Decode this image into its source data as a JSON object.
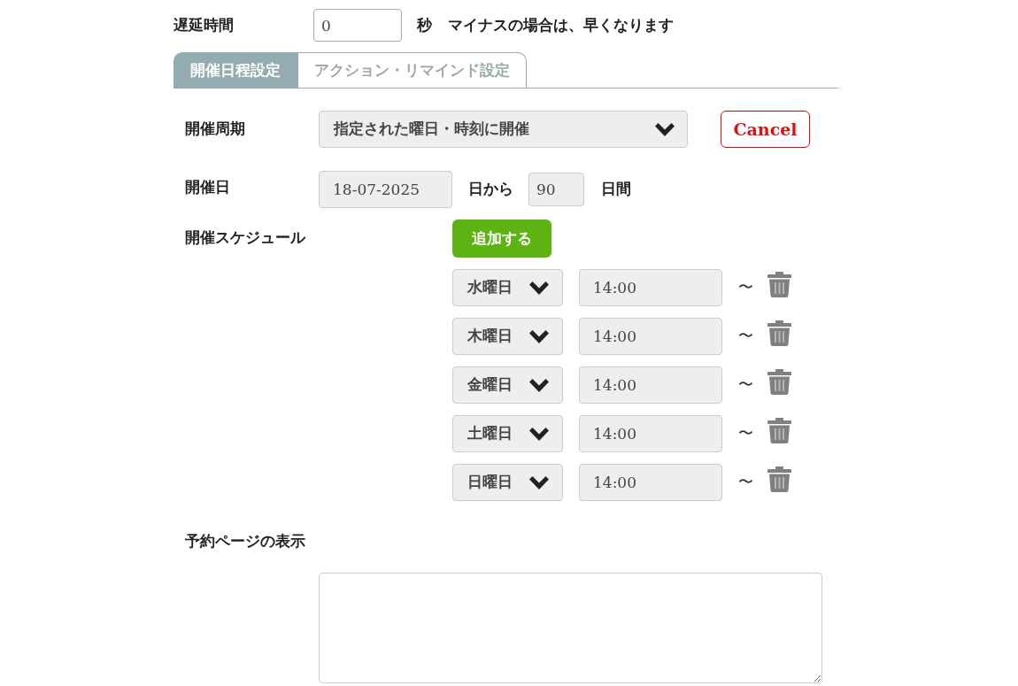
{
  "delay": {
    "label": "遅延時間",
    "value": "0",
    "unit": "秒",
    "note": "マイナスの場合は、早くなります"
  },
  "tabs": [
    {
      "label": "開催日程設定",
      "selected": true
    },
    {
      "label": "アクション・リマインド設定",
      "selected": false
    }
  ],
  "cycle": {
    "label": "開催周期",
    "value": "指定された曜日・時刻に開催"
  },
  "cancel_button": "Cancel",
  "date": {
    "label": "開催日",
    "value": "18-07-2025",
    "from_text": "日から",
    "days": "90",
    "days_unit": "日間"
  },
  "schedule": {
    "label": "開催スケジュール",
    "add_button": "追加する",
    "rows": [
      {
        "day": "水曜日",
        "time": "14:00",
        "separator": "〜"
      },
      {
        "day": "木曜日",
        "time": "14:00",
        "separator": "〜"
      },
      {
        "day": "金曜日",
        "time": "14:00",
        "separator": "〜"
      },
      {
        "day": "土曜日",
        "time": "14:00",
        "separator": "〜"
      },
      {
        "day": "日曜日",
        "time": "14:00",
        "separator": "〜"
      }
    ]
  },
  "booking_page": {
    "label": "予約ページの表示"
  }
}
